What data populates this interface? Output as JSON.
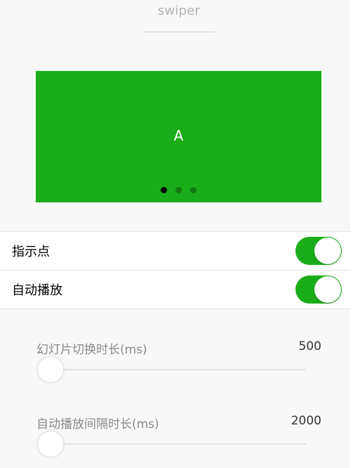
{
  "header": {
    "title": "swiper"
  },
  "swiper": {
    "current_slide_label": "A",
    "slide_count": 3,
    "active_index": 0,
    "background_color": "#1aad19",
    "indicator_active_color": "#000000"
  },
  "switches": [
    {
      "label": "指示点",
      "checked": true
    },
    {
      "label": "自动播放",
      "checked": true
    }
  ],
  "sliders": [
    {
      "label": "幻灯片切换时长(ms)",
      "value": "500"
    },
    {
      "label": "自动播放间隔时长(ms)",
      "value": "2000"
    }
  ],
  "colors": {
    "accent": "#1aad19"
  }
}
